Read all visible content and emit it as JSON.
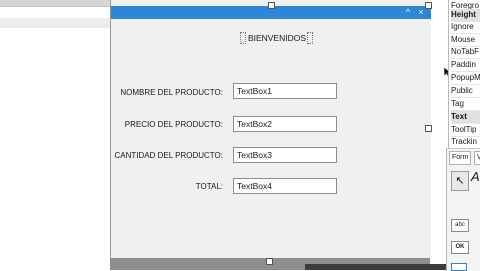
{
  "form": {
    "greeting": "BIENVENIDOS",
    "fields": [
      {
        "label": "NOMBRE DEL PRODUCTO:",
        "value": "TextBox1"
      },
      {
        "label": "PRECIO DEL PRODUCTO:",
        "value": "TextBox2"
      },
      {
        "label": "CANTIDAD DEL PRODUCTO:",
        "value": "TextBox3"
      },
      {
        "label": "TOTAL:",
        "value": "TextBox4"
      }
    ],
    "title_buttons": {
      "collapse": "^",
      "close": "×"
    }
  },
  "properties": {
    "items": [
      {
        "label": "Foregro",
        "bold": false
      },
      {
        "label": "Height",
        "bold": true
      },
      {
        "label": "Ignore",
        "bold": false
      },
      {
        "label": "Mouse",
        "bold": false
      },
      {
        "label": "NoTabF",
        "bold": false
      },
      {
        "label": "Paddin",
        "bold": false
      },
      {
        "label": "PopupM",
        "bold": false
      },
      {
        "label": "Public",
        "bold": false
      },
      {
        "label": "Tag",
        "bold": false
      },
      {
        "label": "Text",
        "bold": true
      },
      {
        "label": "ToolTip",
        "bold": false
      },
      {
        "label": "Trackin",
        "bold": false
      }
    ]
  },
  "toolbox": {
    "tab_form": "Form",
    "tab_v": "V",
    "pointer_glyph": "↖",
    "label_tool": "A",
    "textbox_tool": "abc",
    "button_tool": "OK"
  },
  "colors": {
    "title_bar": "#2e86d4",
    "form_bg": "#f0f0f0",
    "selected_prop_bg": "#e1e1e1"
  }
}
